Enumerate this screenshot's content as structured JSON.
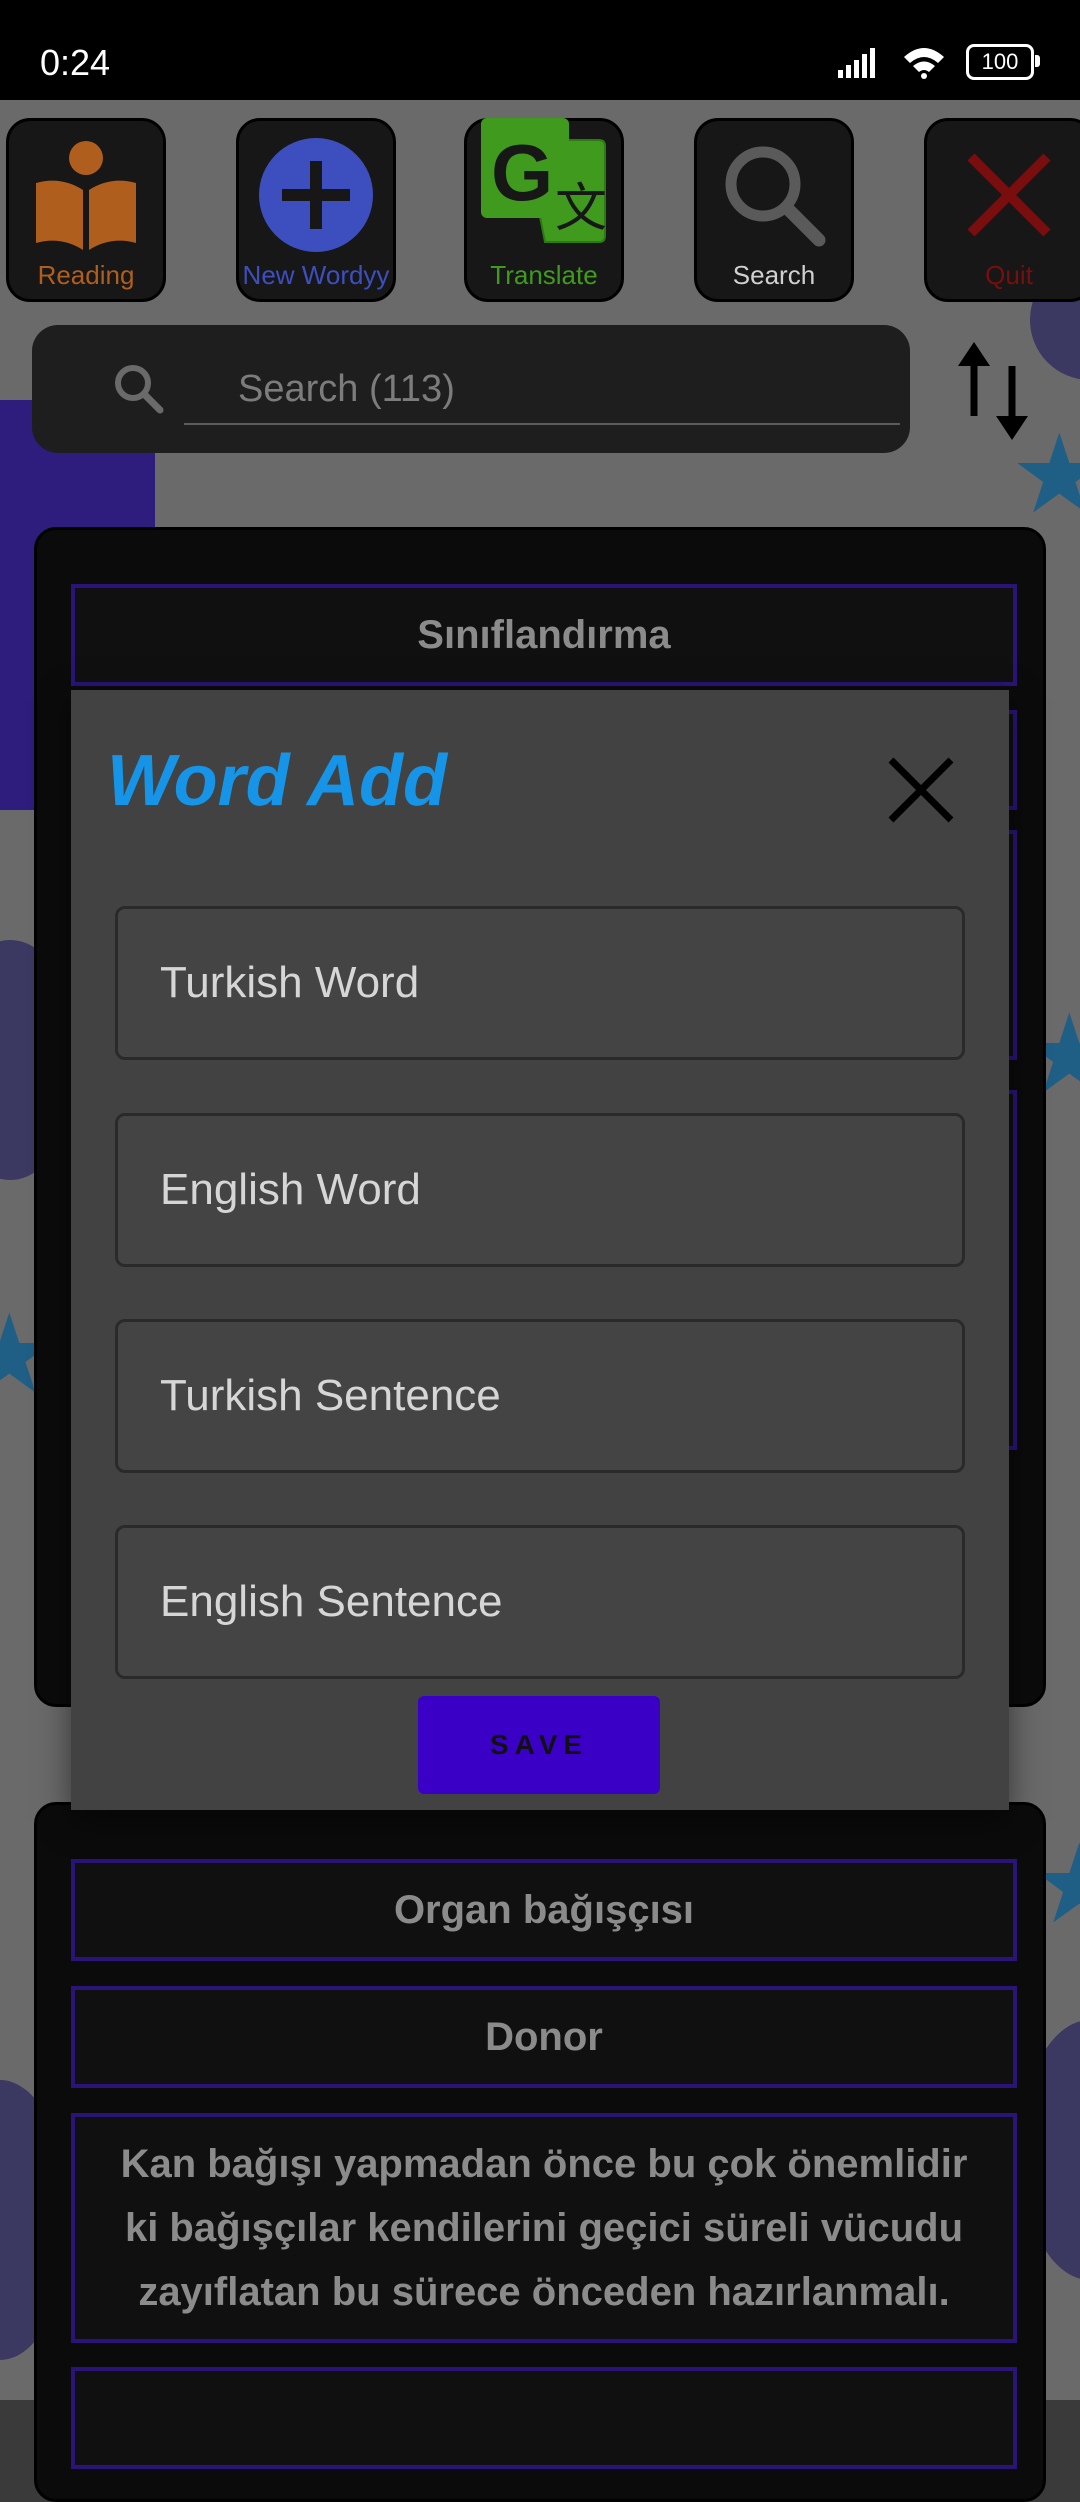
{
  "status_bar": {
    "time": "0:24",
    "battery": "100"
  },
  "toolbar": {
    "reading_label": "Reading",
    "new_wordy_label": "New Wordyy",
    "translate_label": "Translate",
    "search_label": "Search",
    "quit_label": "Quit"
  },
  "search": {
    "placeholder": "Search (113)"
  },
  "cards": {
    "card1_heading": "Sınıflandırma",
    "card2_turkish": "Organ bağışçısı",
    "card2_english": "Donor",
    "card2_sentence": "Kan bağışı yapmadan önce bu çok önemlidir ki bağışçılar kendilerini geçici süreli vücudu zayıflatan bu sürece önceden hazırlanmalı."
  },
  "dialog": {
    "title": "Word Add",
    "turkish_word_placeholder": "Turkish Word",
    "english_word_placeholder": "English Word",
    "turkish_sentence_placeholder": "Turkish Sentence",
    "english_sentence_placeholder": "English Sentence",
    "save_label": "SAVE"
  },
  "colors": {
    "title": "#1695e8",
    "save_button": "#3b00c6",
    "reading": "#b05e1d",
    "new_wordy": "#3d4fbf",
    "translate": "#3f9a1e",
    "quit": "#7a0d0d"
  },
  "icons": [
    "reading-book-icon",
    "plus-icon",
    "google-translate-icon",
    "search-icon",
    "quit-x-icon",
    "sort-arrows-icon",
    "close-icon"
  ]
}
